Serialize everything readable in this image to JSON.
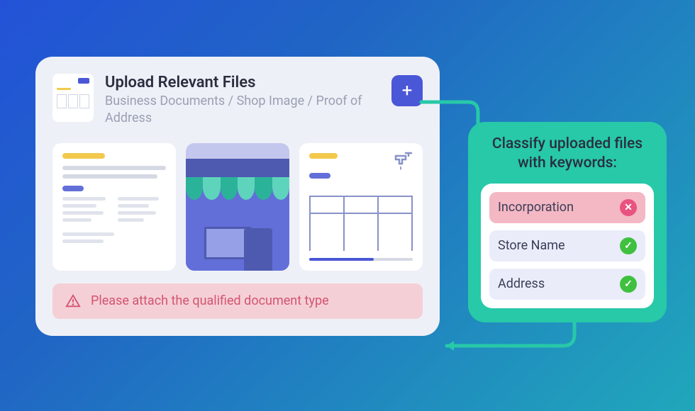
{
  "upload": {
    "title": "Upload Relevant Files",
    "subtitle": "Business Documents / Shop Image / Proof of Address",
    "add_icon": "+"
  },
  "alert": {
    "message": "Please attach the qualified document type"
  },
  "classify": {
    "title": "Classify uploaded files with keywords:",
    "keywords": [
      {
        "label": "Incorporation",
        "status": "error"
      },
      {
        "label": "Store Name",
        "status": "ok"
      },
      {
        "label": "Address",
        "status": "ok"
      }
    ]
  }
}
